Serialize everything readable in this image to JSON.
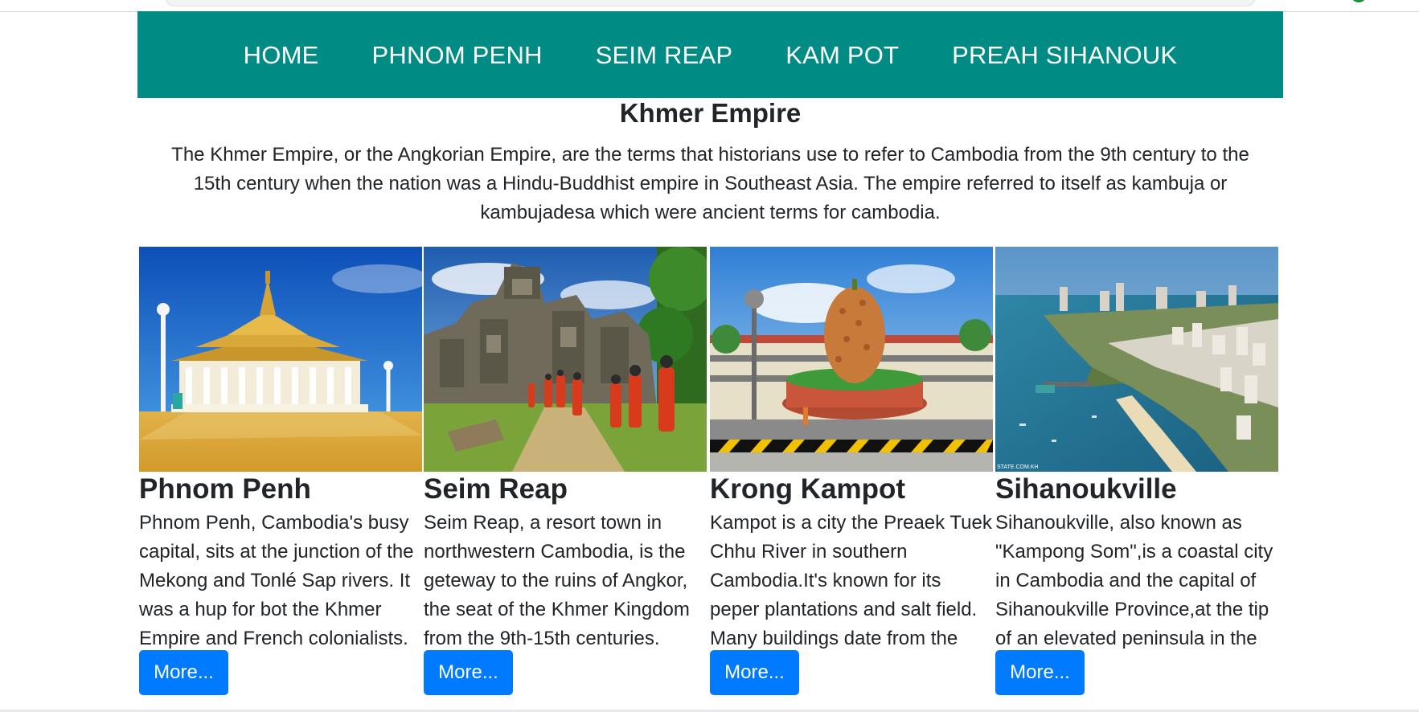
{
  "nav": {
    "items": [
      {
        "label": "HOME"
      },
      {
        "label": "PHNOM PENH"
      },
      {
        "label": "SEIM REAP"
      },
      {
        "label": "KAM POT"
      },
      {
        "label": "PREAH SIHANOUK"
      }
    ]
  },
  "main": {
    "title": "Khmer Empire",
    "intro": "The Khmer Empire, or the Angkorian Empire, are the terms that historians use to refer to Cambodia from the 9th century to the 15th century when the nation was a Hindu-Buddhist empire in Southeast Asia. The empire referred to itself as kambuja or kambujadesa which were ancient terms for cambodia."
  },
  "cards": [
    {
      "title": "Phnom Penh",
      "text": "Phnom Penh, Cambodia's busy capital, sits at the junction of the Mekong and Tonlé Sap rivers. It was a hup for bot the Khmer Empire and French colonialists.",
      "button": "More...",
      "image": "royal-palace-photo"
    },
    {
      "title": "Seim Reap",
      "text": "Seim Reap, a resort town in northwestern Cambodia, is the geteway to the ruins of Angkor, the seat of the Khmer Kingdom from the 9th-15th centuries.",
      "button": "More...",
      "image": "angkor-temple-photo"
    },
    {
      "title": "Krong Kampot",
      "text": "Kampot is a city the Preaek Tuek Chhu River in southern Cambodia.It's known for its peper plantations and salt field. Many buildings date from the",
      "button": "More...",
      "image": "durian-roundabout-photo"
    },
    {
      "title": "Sihanoukville",
      "text": "Sihanoukville, also known as \"Kampong Som\",is a coastal city in Cambodia and the capital of Sihanoukville Province,at the tip of an elevated peninsula in the",
      "button": "More...",
      "image": "coastal-city-photo",
      "watermark": "STATE.COM.KH"
    }
  ],
  "colors": {
    "navbar": "#008b85",
    "button": "#007bff",
    "text": "#212529"
  }
}
